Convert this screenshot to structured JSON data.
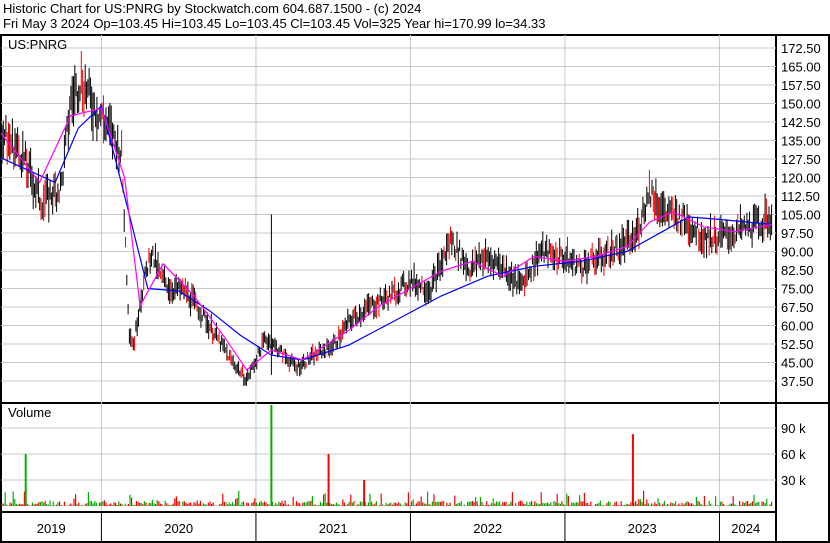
{
  "header": {
    "title": "Historic Chart for US:PNRG by Stockwatch.com 604.687.1500 - (c) 2024",
    "quote": "Fri May  3 2024  Op=103.45  Hi=103.45  Lo=103.45  Cl=103.45  Vol=325  Year hi=170.99  lo=34.33"
  },
  "chart_data": {
    "type": "line",
    "symbol": "US:PNRG",
    "volume_label": "Volume",
    "price_ticks": [
      "172.50",
      "165.00",
      "157.50",
      "150.00",
      "142.50",
      "135.00",
      "127.50",
      "120.00",
      "112.50",
      "105.00",
      "97.50",
      "90.00",
      "82.50",
      "75.00",
      "67.50",
      "60.00",
      "52.50",
      "45.00",
      "37.50"
    ],
    "volume_ticks": [
      "90 k",
      "60 k",
      "30 k"
    ],
    "year_labels": [
      "2019",
      "2020",
      "2021",
      "2022",
      "2023",
      "2024"
    ],
    "ylim": [
      30,
      177
    ],
    "volume_ylim": [
      0,
      105000
    ],
    "x_range": [
      2019.35,
      2024.34
    ],
    "price": {
      "t": [
        2019.35,
        2019.48,
        2019.61,
        2019.74,
        2019.8,
        2019.87,
        2019.94,
        2020.0,
        2020.13,
        2020.18,
        2020.21,
        2020.25,
        2020.32,
        2020.38,
        2020.45,
        2020.54,
        2020.64,
        2020.74,
        2020.84,
        2020.94,
        2021.0,
        2021.06,
        2021.15,
        2021.26,
        2021.38,
        2021.5,
        2021.61,
        2021.74,
        2021.87,
        2022.0,
        2022.13,
        2022.2,
        2022.26,
        2022.39,
        2022.45,
        2022.58,
        2022.71,
        2022.84,
        2022.97,
        2023.1,
        2023.23,
        2023.36,
        2023.45,
        2023.55,
        2023.64,
        2023.77,
        2023.9,
        2024.03,
        2024.16,
        2024.34
      ],
      "close": [
        138,
        130,
        110,
        116,
        150,
        160,
        150,
        145,
        130,
        58,
        52,
        70,
        90,
        80,
        75,
        74,
        66,
        56,
        46,
        38,
        46,
        55,
        50,
        43,
        48,
        52,
        62,
        68,
        72,
        78,
        75,
        85,
        95,
        82,
        88,
        85,
        76,
        90,
        88,
        84,
        88,
        92,
        95,
        115,
        106,
        103,
        96,
        96,
        99,
        103.45
      ]
    },
    "ma_fast": {
      "t": [
        2019.35,
        2019.6,
        2019.8,
        2020.0,
        2020.15,
        2020.25,
        2020.4,
        2020.6,
        2020.8,
        2020.94,
        2021.1,
        2021.3,
        2021.6,
        2021.8,
        2022.0,
        2022.2,
        2022.4,
        2022.6,
        2022.8,
        2023.0,
        2023.2,
        2023.4,
        2023.55,
        2023.7,
        2023.9,
        2024.1,
        2024.34
      ],
      "values": [
        138,
        118,
        145,
        148,
        120,
        68,
        85,
        72,
        55,
        42,
        50,
        46,
        58,
        68,
        75,
        82,
        86,
        80,
        88,
        86,
        88,
        92,
        102,
        106,
        100,
        98,
        101
      ]
    },
    "ma_slow": {
      "t": [
        2019.35,
        2019.7,
        2019.85,
        2020.0,
        2020.1,
        2020.3,
        2020.5,
        2020.7,
        2020.9,
        2021.1,
        2021.3,
        2021.6,
        2021.9,
        2022.2,
        2022.5,
        2022.8,
        2023.1,
        2023.4,
        2023.6,
        2023.8,
        2024.0,
        2024.34
      ],
      "values": [
        128,
        118,
        140,
        149,
        125,
        75,
        74,
        66,
        56,
        48,
        46,
        52,
        62,
        72,
        80,
        84,
        86,
        90,
        97,
        104,
        103,
        101
      ]
    },
    "volume_spikes": [
      {
        "t": 2019.51,
        "value": 60000,
        "color": "green"
      },
      {
        "t": 2021.1,
        "value": 120000,
        "color": "green"
      },
      {
        "t": 2021.47,
        "value": 60000,
        "color": "red"
      },
      {
        "t": 2021.7,
        "value": 30000,
        "color": "red"
      },
      {
        "t": 2023.44,
        "value": 83000,
        "color": "red"
      }
    ],
    "colors": {
      "price": "#000000",
      "down_tick": "#ff0000",
      "ma_fast": "#ff00ff",
      "ma_slow": "#0000ff",
      "vol_up": "#00b000",
      "vol_down": "#ff0000",
      "grid": "#c8c8c8"
    }
  }
}
